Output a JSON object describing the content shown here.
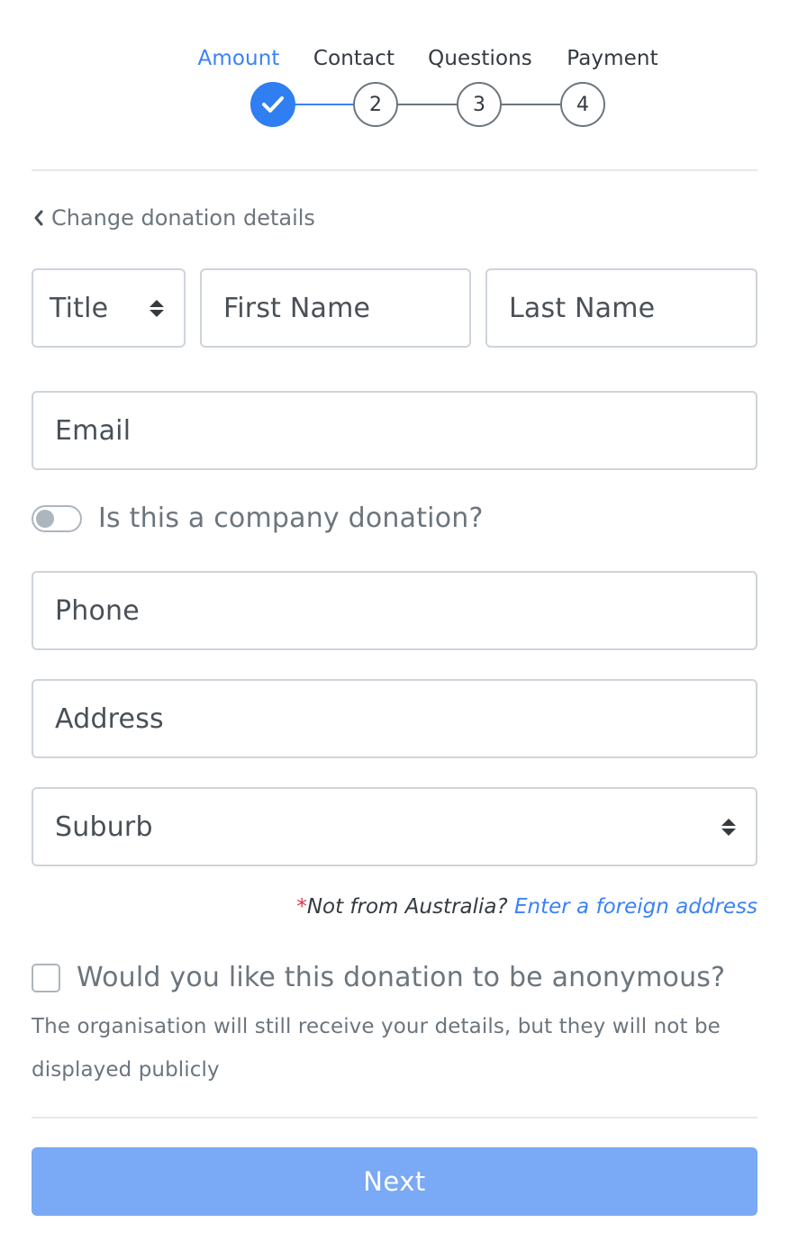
{
  "stepper": {
    "steps": [
      {
        "label": "Amount",
        "number": "",
        "state": "done"
      },
      {
        "label": "Contact",
        "number": "2",
        "state": "todo"
      },
      {
        "label": "Questions",
        "number": "3",
        "state": "todo"
      },
      {
        "label": "Payment",
        "number": "4",
        "state": "todo"
      }
    ]
  },
  "back_link": {
    "icon": "chevron-left-icon",
    "label": "Change donation details"
  },
  "form": {
    "title_select": {
      "value": "Title"
    },
    "first_name": {
      "placeholder": "First Name"
    },
    "last_name": {
      "placeholder": "Last Name"
    },
    "email": {
      "placeholder": "Email"
    },
    "company_toggle": {
      "label": "Is this a company donation?",
      "on": false
    },
    "phone": {
      "placeholder": "Phone"
    },
    "address": {
      "placeholder": "Address"
    },
    "suburb_select": {
      "value": "Suburb"
    },
    "foreign": {
      "star": "*",
      "prefix": "Not from Australia? ",
      "link": "Enter a foreign address"
    },
    "anonymous": {
      "label": "Would you like this donation to be anonymous?",
      "checked": false,
      "help": "The organisation will still receive your details, but they will not be displayed publicly"
    },
    "next_label": "Next"
  },
  "colors": {
    "accent": "#3b82f6",
    "button": "#7aa9f5",
    "required": "#dc3545"
  }
}
